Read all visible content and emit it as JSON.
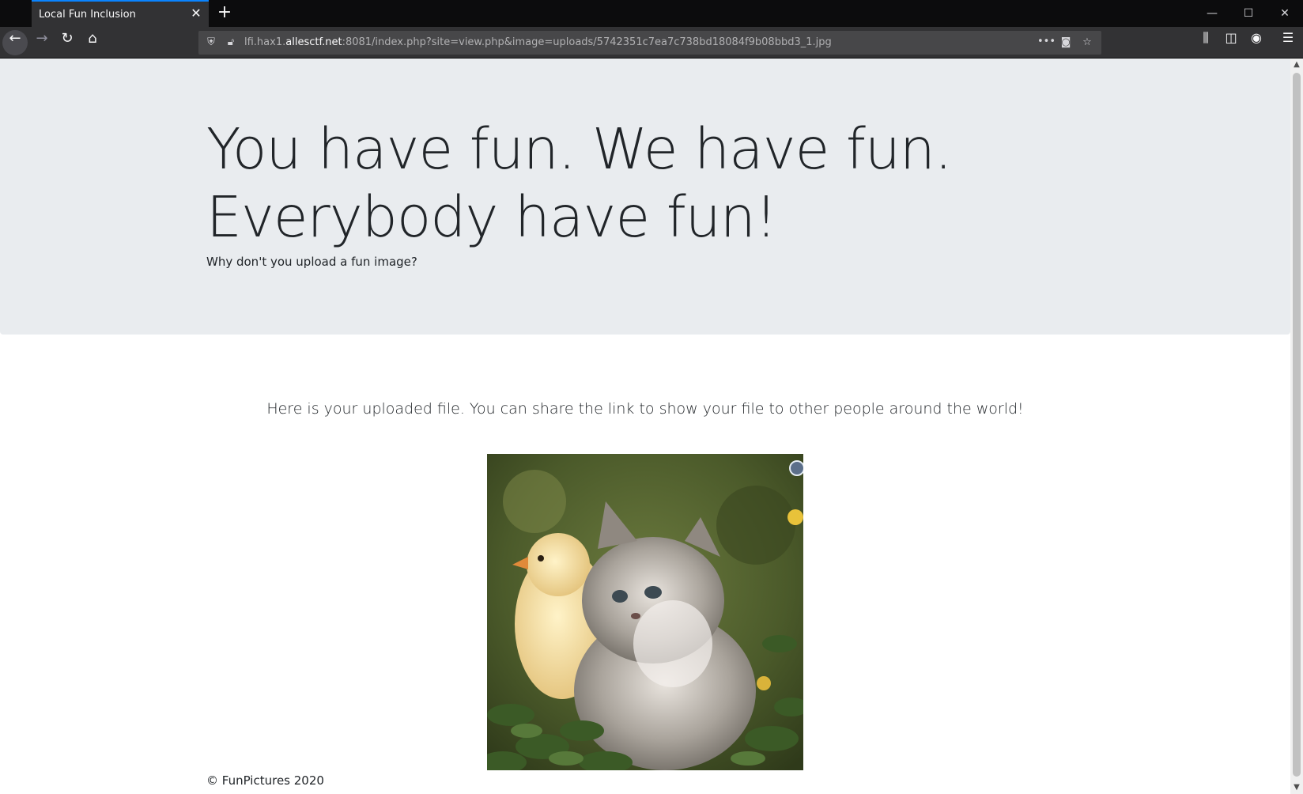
{
  "browser": {
    "tab_title": "Local Fun Inclusion",
    "tab_close_icon": "close-icon",
    "new_tab_icon": "plus-icon",
    "url_scheme_host_prefix": "lfi.hax1.",
    "url_host": "allesctf.net",
    "url_rest": ":8081/index.php?site=view.php&image=uploads/5742351c7ea7c738bd18084f9b08bbd3_1.jpg",
    "page_actions_icon": "more-icon"
  },
  "page": {
    "headline_line1": "You have fun. We have fun.",
    "headline_line2": "Everybody have fun!",
    "lead": "Why don't you upload a fun image?",
    "info": "Here is your uploaded file. You can share the link to show your file to other people around the world!",
    "image_alt": "kitten and chick",
    "footer": "© FunPictures 2020"
  },
  "colors": {
    "jumbotron_bg": "#e9ecef",
    "text": "#212529",
    "tab_accent": "#0a84ff",
    "chrome_dark": "#0c0c0d",
    "chrome_toolbar": "#323234"
  }
}
